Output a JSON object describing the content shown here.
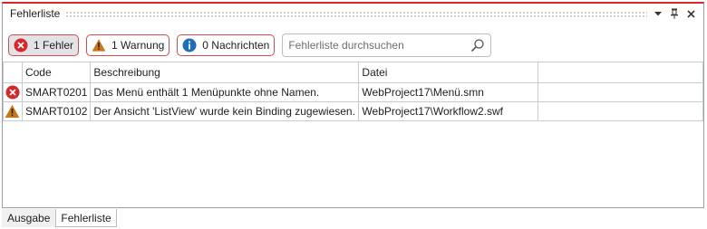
{
  "panel": {
    "title": "Fehlerliste",
    "title_buttons": [
      "dropdown-icon",
      "pin-icon",
      "close-icon"
    ]
  },
  "toolbar": {
    "errors_label": "1 Fehler",
    "warnings_label": "1 Warnung",
    "messages_label": "0 Nachrichten",
    "search_placeholder": "Fehlerliste durchsuchen"
  },
  "table": {
    "columns": [
      "",
      "Code",
      "Beschreibung",
      "Datei",
      ""
    ],
    "rows": [
      {
        "severity": "error",
        "code": "SMART0201",
        "description": "Das Menü enthält 1 Menüpunkte ohne Namen.",
        "file": "WebProject17\\Menü.smn"
      },
      {
        "severity": "warning",
        "code": "SMART0102",
        "description": "Der Ansicht 'ListView' wurde kein Binding zugewiesen.",
        "file": "WebProject17\\Workflow2.swf"
      }
    ]
  },
  "tabs": [
    {
      "label": "Ausgabe",
      "active": false
    },
    {
      "label": "Fehlerliste",
      "active": true
    }
  ],
  "colors": {
    "accent": "#d9262b",
    "error": "#d9262b",
    "warning": "#c9771a",
    "info": "#1d6fb8"
  }
}
